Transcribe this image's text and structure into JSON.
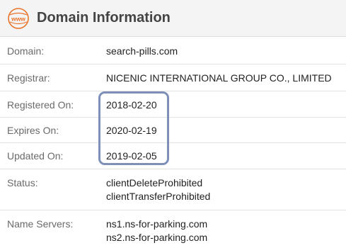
{
  "header": {
    "icon_text": "www",
    "title": "Domain Information"
  },
  "rows": [
    {
      "label": "Domain:",
      "values": [
        "search-pills.com"
      ]
    },
    {
      "label": "Registrar:",
      "values": [
        "NICENIC INTERNATIONAL GROUP CO., LIMITED"
      ]
    },
    {
      "label": "Registered On:",
      "values": [
        "2018-02-20"
      ]
    },
    {
      "label": "Expires On:",
      "values": [
        "2020-02-19"
      ]
    },
    {
      "label": "Updated On:",
      "values": [
        "2019-02-05"
      ]
    },
    {
      "label": "Status:",
      "values": [
        "clientDeleteProhibited",
        "clientTransferProhibited"
      ]
    },
    {
      "label": "Name Servers:",
      "values": [
        "ns1.ns-for-parking.com",
        "ns2.ns-for-parking.com"
      ]
    }
  ],
  "colors": {
    "icon_accent": "#e8742c",
    "highlight_border": "#7f90b8"
  }
}
